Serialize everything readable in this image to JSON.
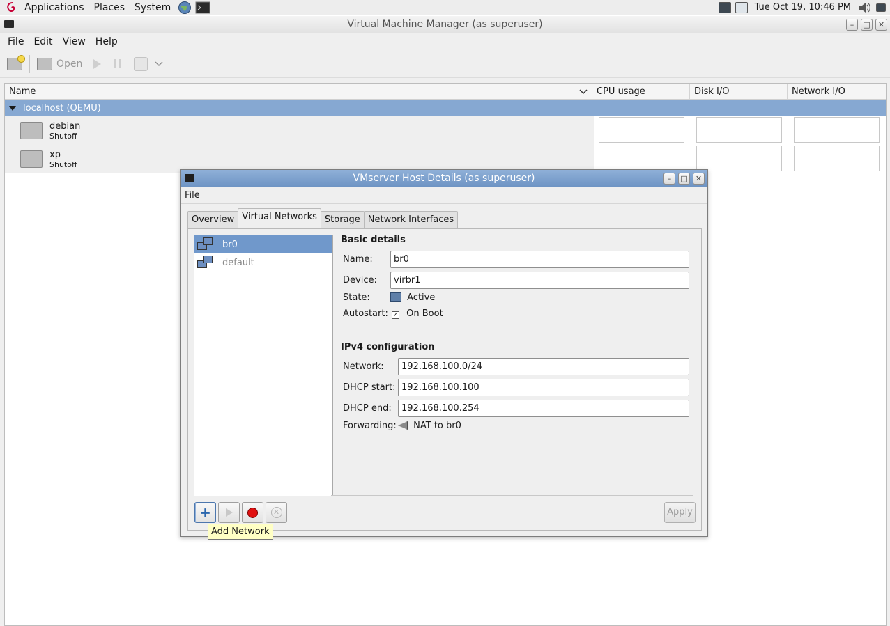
{
  "top_panel": {
    "menus": [
      "Applications",
      "Places",
      "System"
    ],
    "clock": "Tue Oct 19, 10:46 PM"
  },
  "main_window": {
    "title": "Virtual Machine Manager (as superuser)",
    "menus": [
      "File",
      "Edit",
      "View",
      "Help"
    ],
    "toolbar": {
      "open_label": "Open"
    },
    "columns": [
      "Name",
      "CPU usage",
      "Disk I/O",
      "Network I/O"
    ],
    "group_label": "localhost (QEMU)",
    "vms": [
      {
        "name": "debian",
        "status": "Shutoff"
      },
      {
        "name": "xp",
        "status": "Shutoff"
      }
    ]
  },
  "host_dialog": {
    "title": "VMserver Host Details (as superuser)",
    "menu_file": "File",
    "tabs": [
      "Overview",
      "Virtual Networks",
      "Storage",
      "Network Interfaces"
    ],
    "active_tab": "Virtual Networks",
    "networks": [
      {
        "name": "br0",
        "selected": true
      },
      {
        "name": "default",
        "selected": false
      }
    ],
    "basic_details": {
      "title": "Basic details",
      "name_label": "Name:",
      "name_value": "br0",
      "device_label": "Device:",
      "device_value": "virbr1",
      "state_label": "State:",
      "state_value": "Active",
      "autostart_label": "Autostart:",
      "autostart_value": "On Boot",
      "autostart_checked": "✓"
    },
    "ipv4": {
      "title": "IPv4 configuration",
      "network_label": "Network:",
      "network_value": "192.168.100.0/24",
      "dhcp_start_label": "DHCP start:",
      "dhcp_start_value": "192.168.100.100",
      "dhcp_end_label": "DHCP end:",
      "dhcp_end_value": "192.168.100.254",
      "forwarding_label": "Forwarding:",
      "forwarding_value": "NAT to br0"
    },
    "apply_label": "Apply",
    "tooltip": "Add Network"
  }
}
